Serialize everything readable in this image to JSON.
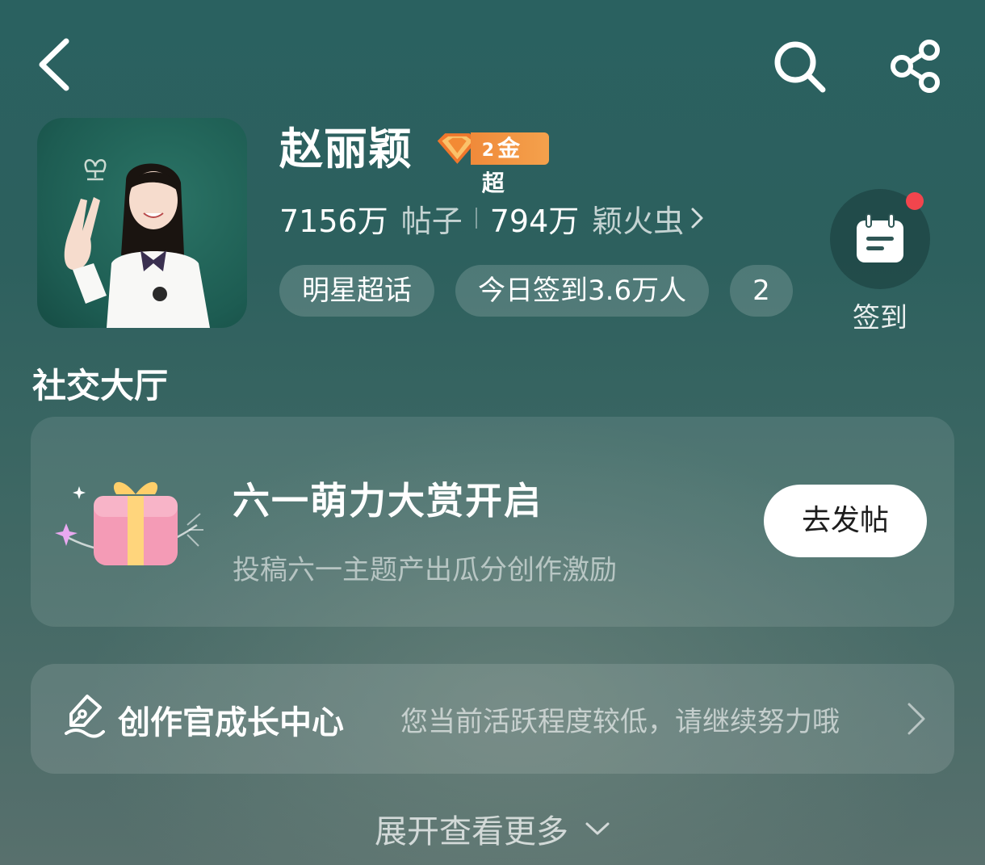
{
  "header": {
    "back_icon": "chevron-left-icon",
    "search_icon": "search-icon",
    "share_icon": "share-icon"
  },
  "topic": {
    "name": "赵丽颖",
    "badge": {
      "level": "2",
      "label": "金超",
      "icon": "diamond-icon"
    },
    "stats": {
      "posts_count": "7156万",
      "posts_label": "帖子",
      "fans_count": "794万",
      "fans_label": "颖火虫"
    },
    "tags": [
      "明星超话",
      "今日签到3.6万人",
      "2"
    ],
    "checkin": {
      "label": "签到",
      "icon": "calendar-icon",
      "has_notification": true
    }
  },
  "social_hall": {
    "title": "社交大厅",
    "promo": {
      "title": "六一萌力大赏开启",
      "subtitle": "投稿六一主题产出瓜分创作激励",
      "button": "去发帖",
      "icon": "gift-icon"
    },
    "creator_center": {
      "title": "创作官成长中心",
      "status": "您当前活跃程度较低，请继续努力哦",
      "icon": "quill-icon"
    }
  },
  "expand": {
    "label": "展开查看更多",
    "icon": "chevron-down-icon"
  },
  "colors": {
    "accent_badge": "#f08a3a",
    "notification_dot": "#f2454d",
    "bg_top": "#2a6160",
    "bg_bottom": "#58706d"
  }
}
